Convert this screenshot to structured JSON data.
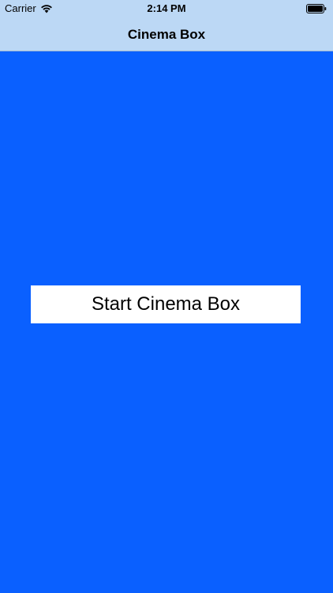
{
  "status_bar": {
    "carrier": "Carrier",
    "time": "2:14 PM",
    "wifi_icon": "wifi-icon",
    "battery_icon": "battery-icon"
  },
  "nav": {
    "title": "Cinema Box"
  },
  "main": {
    "start_button_label": "Start Cinema Box"
  },
  "colors": {
    "background": "#0a60ff",
    "nav_background": "#bcd8f5",
    "button_background": "#ffffff"
  }
}
